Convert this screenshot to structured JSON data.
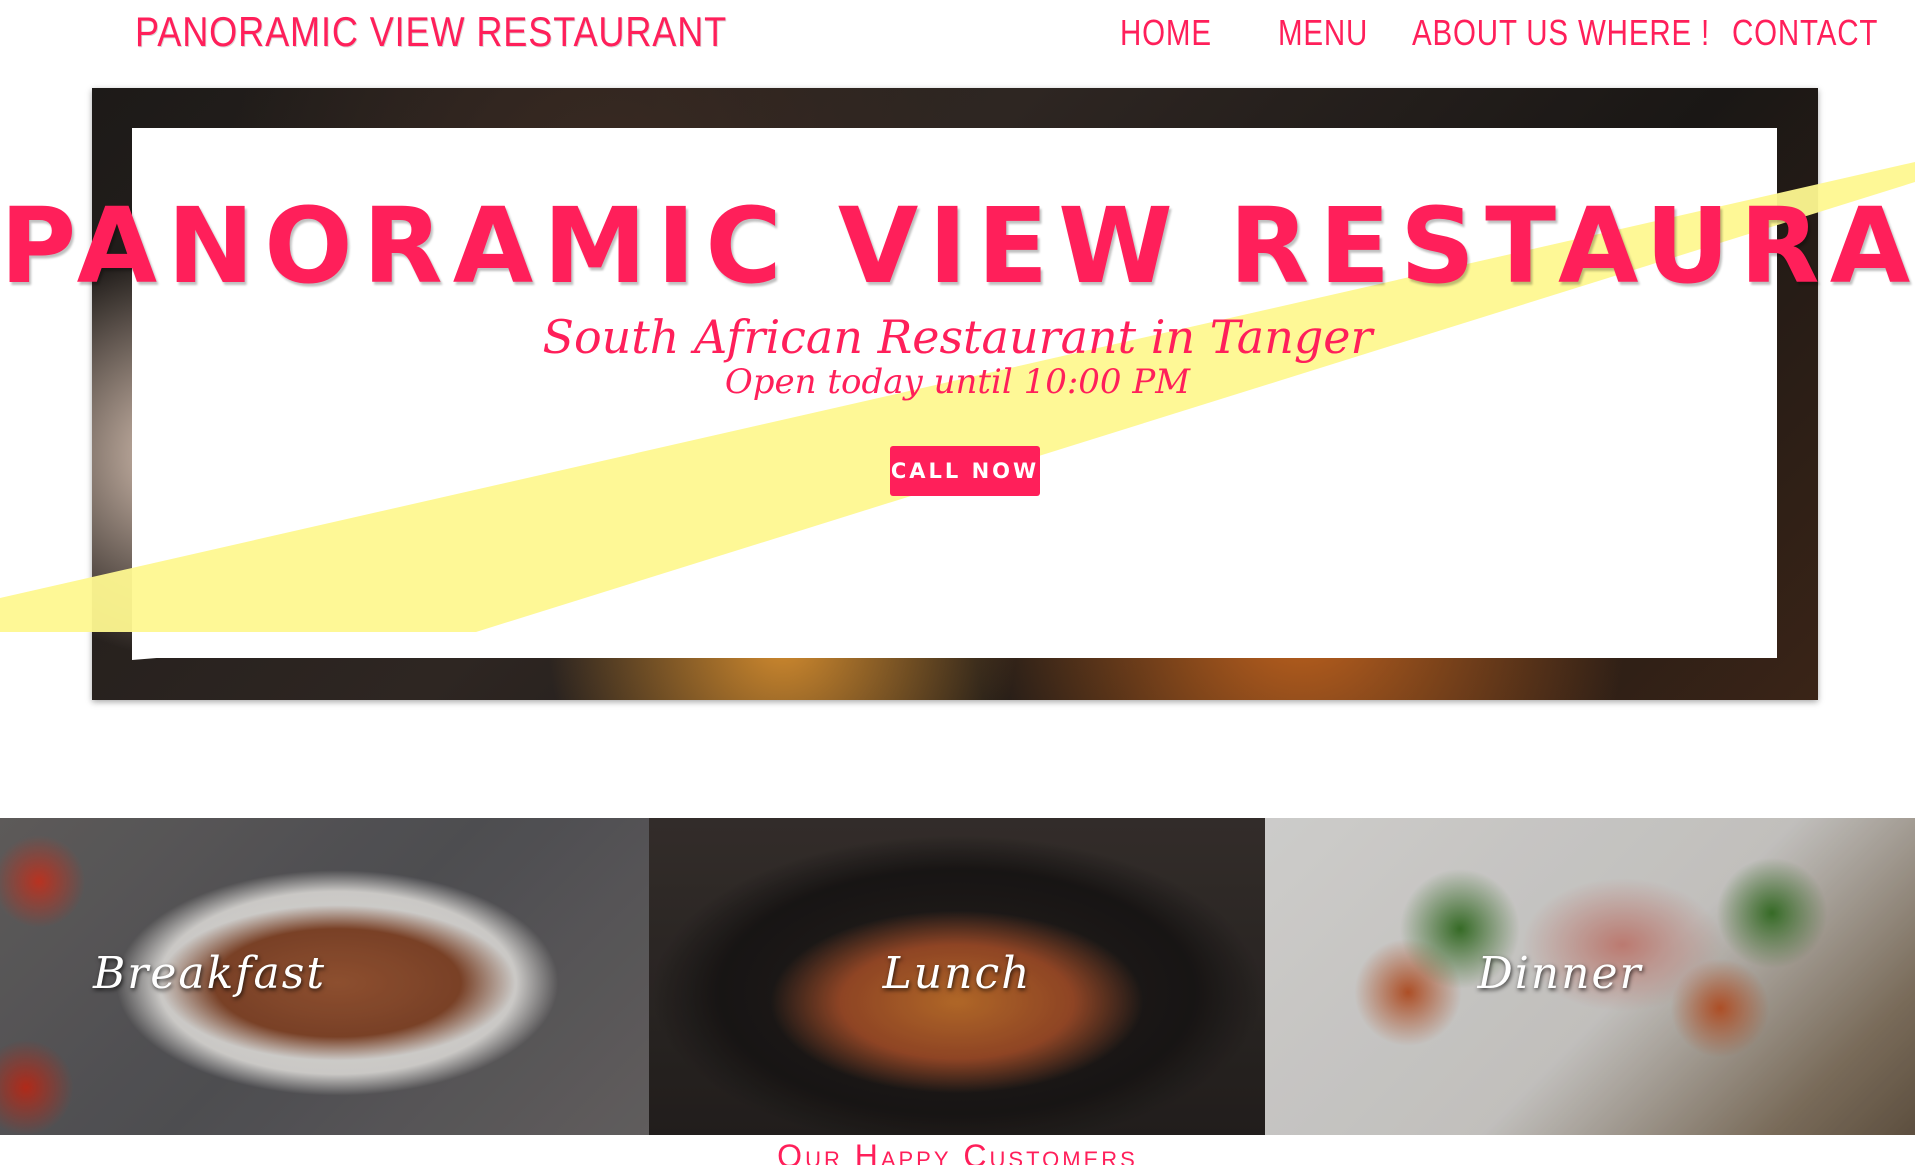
{
  "header": {
    "site_title": "PANORAMIC VIEW RESTAURANT",
    "nav": [
      "HOME",
      "MENU",
      "ABOUT US",
      "WHERE !",
      "CONTACT"
    ]
  },
  "hero": {
    "title": "PANORAMIC VIEW RESTAURANT",
    "subtitle": "South African Restaurant in Tanger",
    "hours": "Open today until 10:00 PM",
    "cta_label": "CALL NOW"
  },
  "meals": [
    "Breakfast",
    "Lunch",
    "Dinner"
  ],
  "customers_heading": "Our Happy Customers",
  "colors": {
    "accent": "#ff1f5a",
    "highlight": "#fef890"
  }
}
